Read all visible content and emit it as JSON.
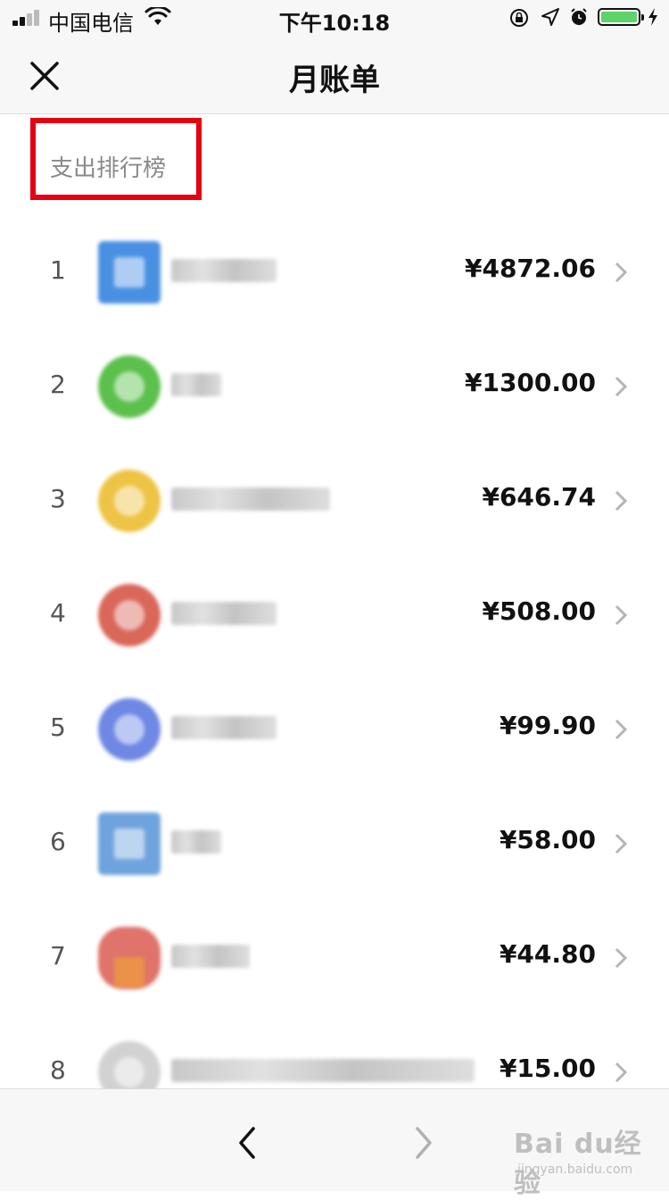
{
  "status_bar": {
    "carrier": "中国电信",
    "time": "下午10:18"
  },
  "nav": {
    "title": "月账单"
  },
  "section": {
    "title": "支出排行榜"
  },
  "ranking": [
    {
      "rank": "1",
      "amount": "¥4872.06",
      "color": "#4a90e2"
    },
    {
      "rank": "2",
      "amount": "¥1300.00",
      "color": "#5cc04c"
    },
    {
      "rank": "3",
      "amount": "¥646.74",
      "color": "#eec445"
    },
    {
      "rank": "4",
      "amount": "¥508.00",
      "color": "#d9675a"
    },
    {
      "rank": "5",
      "amount": "¥99.90",
      "color": "#6e88e4"
    },
    {
      "rank": "6",
      "amount": "¥58.00",
      "color": "#6fa3dd"
    },
    {
      "rank": "7",
      "amount": "¥44.80",
      "color": "#e0736a"
    },
    {
      "rank": "8",
      "amount": "¥15.00",
      "color": "#d2d2d2"
    }
  ],
  "watermark": {
    "brand": "Bai du经验",
    "url": "jingyan.baidu.com"
  },
  "colors": {
    "highlight_border": "#e60012",
    "battery_fill": "#5ed36a"
  }
}
